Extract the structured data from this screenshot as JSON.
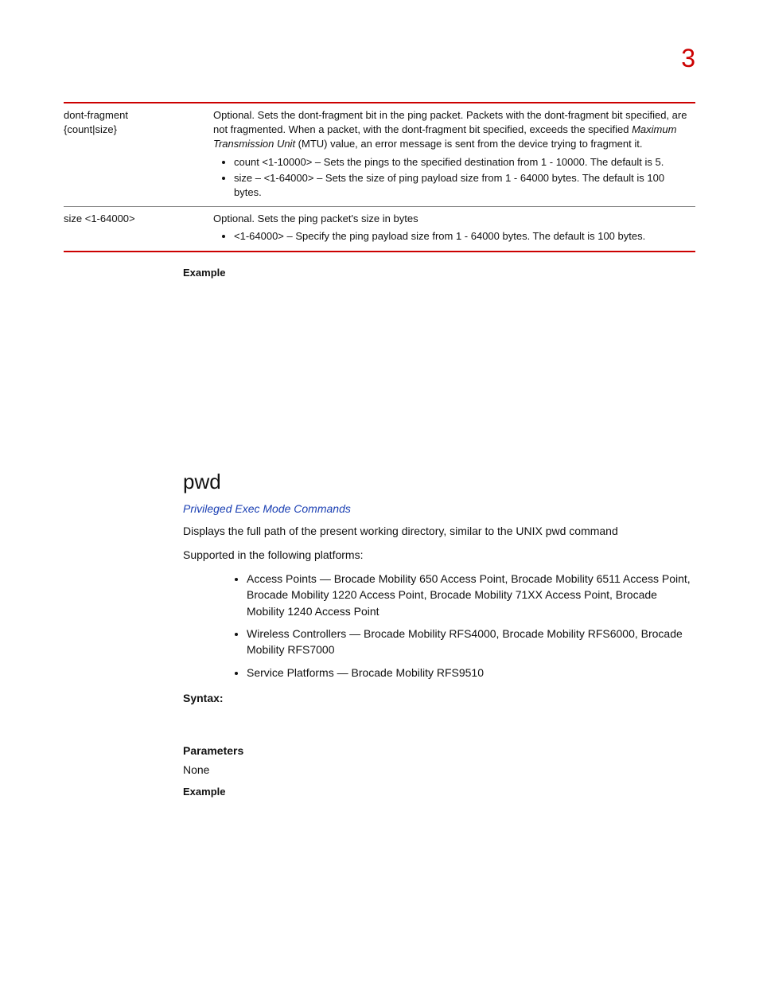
{
  "chapter_number": "3",
  "param_table": {
    "rows": [
      {
        "name_l1": "dont-fragment",
        "name_l2": "{count|size}",
        "desc_line1_a": "Optional. Sets the dont-fragment bit in the ping packet. Packets with the dont-fragment bit specified, are not fragmented. When a packet, with the dont-fragment bit specified, exceeds the specified ",
        "desc_line1_em": "Maximum Transmission Unit",
        "desc_line1_b": " (MTU) value, an error message is sent from the device trying to fragment it.",
        "bullets": [
          "count <1-10000> – Sets the pings to the specified destination from 1 - 10000. The default is 5.",
          "size – <1-64000> – Sets the size of ping payload size from 1 - 64000 bytes. The default is 100 bytes."
        ]
      },
      {
        "name_l1": "size <1-64000>",
        "name_l2": "",
        "desc_line1_a": "Optional. Sets the ping packet's size in bytes",
        "desc_line1_em": "",
        "desc_line1_b": "",
        "bullets": [
          "<1-64000> – Specify the ping payload size from 1 - 64000 bytes. The default is 100 bytes."
        ]
      }
    ]
  },
  "example_label": "Example",
  "command_heading": "pwd",
  "xref": "Privileged Exec Mode Commands",
  "description": "Displays the full path of the present working directory, similar to the UNIX pwd command",
  "supported_intro": "Supported in the following platforms:",
  "platforms": [
    "Access Points — Brocade Mobility 650 Access Point, Brocade Mobility 6511 Access Point, Brocade Mobility 1220 Access Point, Brocade Mobility 71XX Access Point, Brocade Mobility 1240 Access Point",
    "Wireless Controllers — Brocade Mobility RFS4000, Brocade Mobility RFS6000, Brocade Mobility RFS7000",
    "Service Platforms — Brocade Mobility RFS9510"
  ],
  "syntax_label": "Syntax:",
  "parameters_label": "Parameters",
  "parameters_value": "None",
  "example2_label": "Example"
}
